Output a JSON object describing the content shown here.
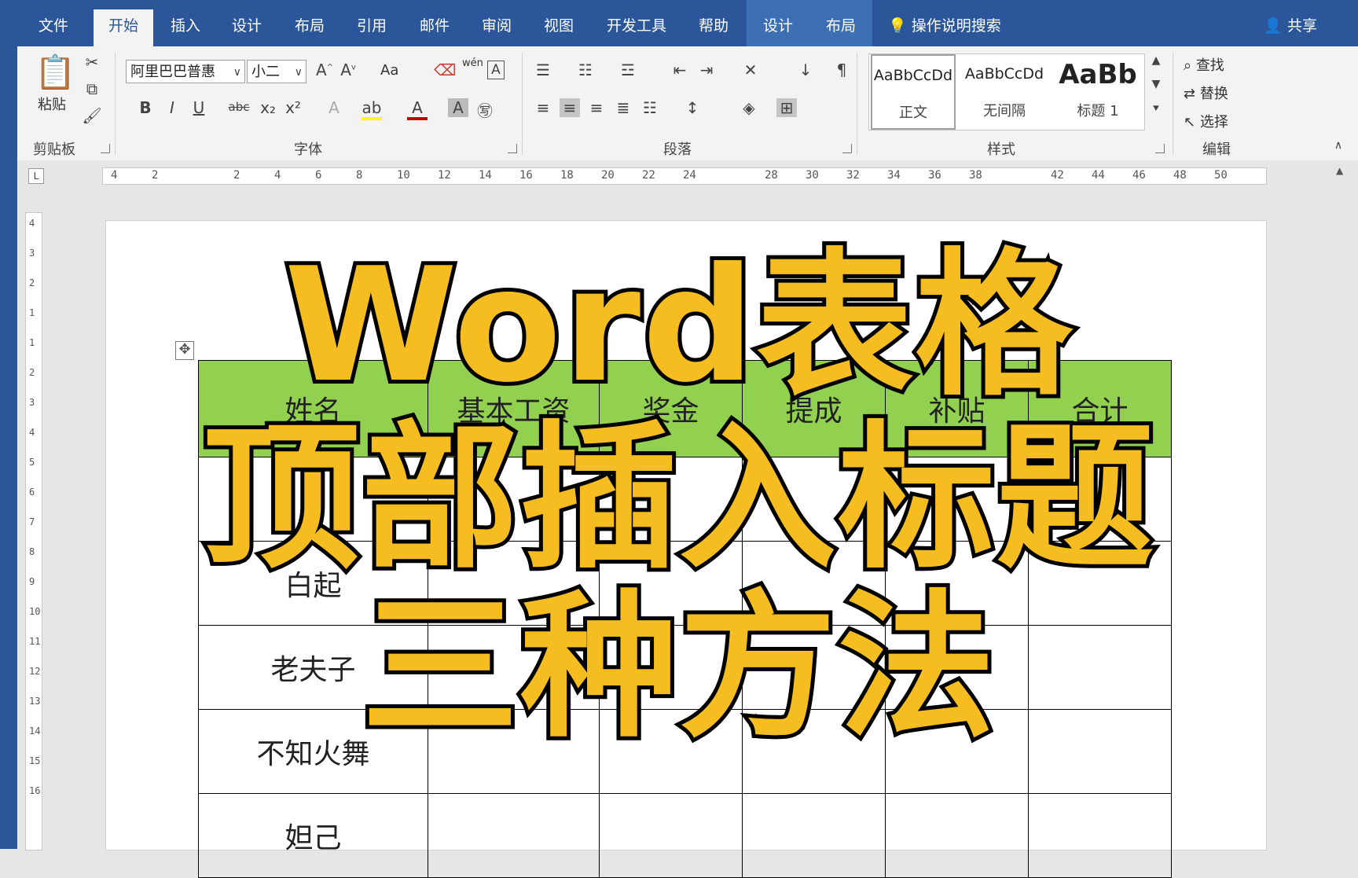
{
  "tabs": [
    {
      "label": "文件",
      "state": "normal"
    },
    {
      "label": "开始",
      "state": "active"
    },
    {
      "label": "插入",
      "state": "normal"
    },
    {
      "label": "设计",
      "state": "normal"
    },
    {
      "label": "布局",
      "state": "normal"
    },
    {
      "label": "引用",
      "state": "normal"
    },
    {
      "label": "邮件",
      "state": "normal"
    },
    {
      "label": "审阅",
      "state": "normal"
    },
    {
      "label": "视图",
      "state": "normal"
    },
    {
      "label": "开发工具",
      "state": "normal"
    },
    {
      "label": "帮助",
      "state": "normal"
    },
    {
      "label": "设计",
      "state": "contextual"
    },
    {
      "label": "布局",
      "state": "contextual"
    }
  ],
  "tell_me": "操作说明搜索",
  "share": "共享",
  "ribbon": {
    "clipboard": {
      "paste": "粘贴",
      "group": "剪贴板"
    },
    "font": {
      "name": "阿里巴巴普惠",
      "size": "小二",
      "group": "字体",
      "change_case": "Aa",
      "phonetic": "wén"
    },
    "paragraph": {
      "group": "段落"
    },
    "styles": {
      "group": "样式",
      "items": [
        {
          "sample": "AaBbCcDd",
          "name": "正文"
        },
        {
          "sample": "AaBbCcDd",
          "name": "无间隔"
        },
        {
          "sample": "AaBb",
          "name": "标题 1"
        }
      ]
    },
    "editing": {
      "group": "编辑",
      "find": "查找",
      "replace": "替换",
      "select": "选择"
    }
  },
  "ruler": {
    "h_ticks": [
      "4",
      "2",
      "",
      "2",
      "4",
      "6",
      "8",
      "10",
      "12",
      "14",
      "16",
      "18",
      "20",
      "22",
      "24",
      "",
      "28",
      "30",
      "32",
      "34",
      "36",
      "38",
      "",
      "42",
      "44",
      "46",
      "48",
      "50"
    ],
    "v_ticks": [
      "4",
      "3",
      "2",
      "1",
      "1",
      "2",
      "3",
      "4",
      "5",
      "6",
      "7",
      "8",
      "9",
      "10",
      "11",
      "12",
      "13",
      "14",
      "15",
      "16"
    ]
  },
  "table": {
    "headers": [
      "姓名",
      "基本工资",
      "奖金",
      "提成",
      "补贴",
      "合计"
    ],
    "rows": [
      [
        "",
        "",
        "",
        "",
        "",
        ""
      ],
      [
        "白起",
        "",
        "",
        "",
        "",
        ""
      ],
      [
        "老夫子",
        "",
        "",
        "",
        "",
        ""
      ],
      [
        "不知火舞",
        "",
        "",
        "",
        "",
        ""
      ],
      [
        "妲己",
        "",
        "",
        "",
        "",
        ""
      ]
    ]
  },
  "overlay": {
    "line1": "Word表格",
    "line2": "顶部插入标题",
    "line3": "三种方法"
  },
  "colors": {
    "title_bar": "#2b579a",
    "header_fill": "#92d050",
    "overlay_text": "#f5bd1f"
  }
}
